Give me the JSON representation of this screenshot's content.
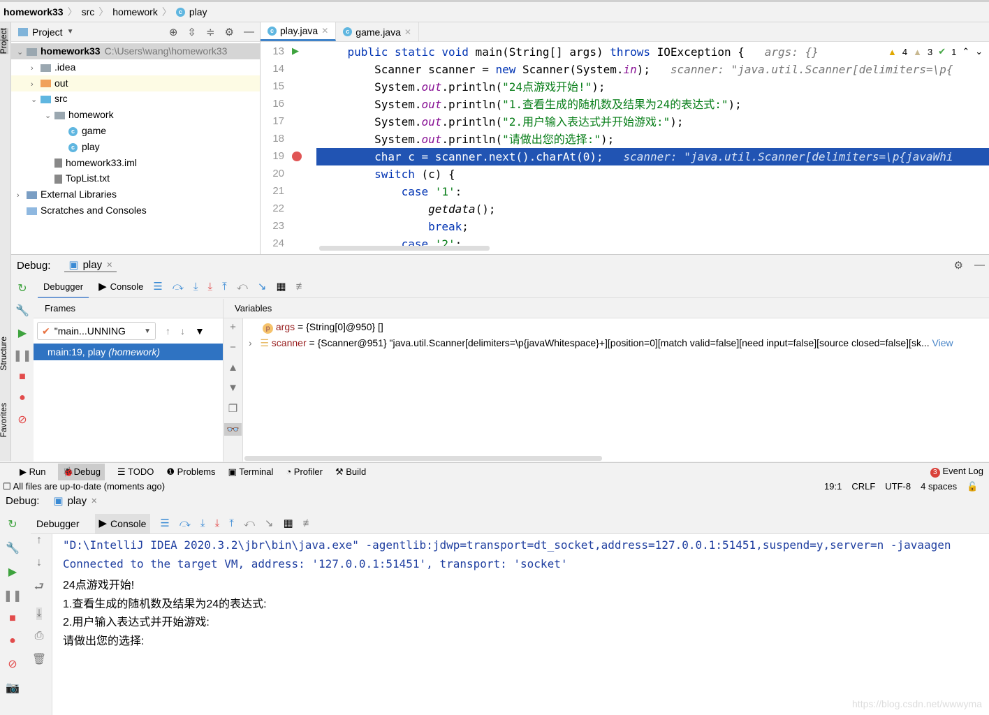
{
  "breadcrumb": [
    "homework33",
    "src",
    "homework",
    "play"
  ],
  "project": {
    "title": "Project",
    "tree": [
      {
        "label": "homework33",
        "path": "C:\\Users\\wang\\homework33",
        "depth": 0,
        "arrow": "v"
      },
      {
        "label": ".idea",
        "depth": 1,
        "arrow": ">"
      },
      {
        "label": "out",
        "depth": 1,
        "arrow": ">"
      },
      {
        "label": "src",
        "depth": 1,
        "arrow": "v"
      },
      {
        "label": "homework",
        "depth": 2,
        "arrow": "v"
      },
      {
        "label": "game",
        "depth": 3
      },
      {
        "label": "play",
        "depth": 3
      },
      {
        "label": "homework33.iml",
        "depth": 2
      },
      {
        "label": "TopList.txt",
        "depth": 2
      },
      {
        "label": "External Libraries",
        "depth": 0,
        "arrow": ">"
      },
      {
        "label": "Scratches and Consoles",
        "depth": 0
      }
    ]
  },
  "side_labels": {
    "project": "Project",
    "structure": "Structure",
    "favorites": "Favorites"
  },
  "editor": {
    "tabs": [
      "play.java",
      "game.java"
    ],
    "inspections": {
      "warnings": "4",
      "weak_warnings": "3",
      "ok": "1"
    },
    "lines": [
      {
        "n": "13",
        "html": "    <span class='kw'>public static void</span> main(String[] args) <span class='kw'>throws</span> IOException {   <span class='hint'>args: {}</span>"
      },
      {
        "n": "14",
        "html": "        Scanner scanner = <span class='kw'>new</span> Scanner(System.<span class='fld'>in</span>);   <span class='hint'>scanner: \"java.util.Scanner[delimiters=\\p{</span>"
      },
      {
        "n": "15",
        "html": "        System.<span class='fld'>out</span>.println(<span class='str'>\"24点游戏开始!\"</span>);"
      },
      {
        "n": "16",
        "html": "        System.<span class='fld'>out</span>.println(<span class='str'>\"1.查看生成的随机数及结果为24的表达式:\"</span>);"
      },
      {
        "n": "17",
        "html": "        System.<span class='fld'>out</span>.println(<span class='str'>\"2.用户输入表达式并开始游戏:\"</span>);"
      },
      {
        "n": "18",
        "html": "        System.<span class='fld'>out</span>.println(<span class='str'>\"请做出您的选择:\"</span>);"
      },
      {
        "n": "19",
        "html": "        char c = scanner.next().charAt(<span>0</span>);   <span class='hint'>scanner: \"java.util.Scanner[delimiters=\\p{javaWhi</span>"
      },
      {
        "n": "20",
        "html": "        <span class='kw'>switch</span> (c) {"
      },
      {
        "n": "21",
        "html": "            <span class='kw'>case</span> <span class='str'>'1'</span>:"
      },
      {
        "n": "22",
        "html": "                <i>getdata</i>();"
      },
      {
        "n": "23",
        "html": "                <span class='kw'>break</span>;"
      },
      {
        "n": "24",
        "html": "            <span class='kw'>case</span> <span class='str'>'2'</span>:"
      }
    ]
  },
  "debug": {
    "label": "Debug:",
    "session": "play",
    "tabs": {
      "debugger": "Debugger",
      "console": "Console"
    },
    "frames_title": "Frames",
    "variables_title": "Variables",
    "thread": "\"main...UNNING",
    "frame": "main:19, play",
    "frame_pkg": "(homework)",
    "variables": [
      {
        "name": "args",
        "value": "{String[0]@950} []"
      },
      {
        "name": "scanner",
        "value": "{Scanner@951} \"java.util.Scanner[delimiters=\\p{javaWhitespace}+][position=0][match valid=false][need input=false][source closed=false][sk...",
        "link": "View"
      }
    ]
  },
  "bottom_tools": [
    "Run",
    "Debug",
    "TODO",
    "Problems",
    "Terminal",
    "Profiler",
    "Build"
  ],
  "event_log": {
    "label": "Event Log",
    "count": "3"
  },
  "status": {
    "message": "All files are up-to-date (moments ago)",
    "position": "19:1",
    "line_sep": "CRLF",
    "encoding": "UTF-8",
    "indent": "4 spaces"
  },
  "console_lines": [
    "\"D:\\IntelliJ IDEA 2020.3.2\\jbr\\bin\\java.exe\" -agentlib:jdwp=transport=dt_socket,address=127.0.0.1:51451,suspend=y,server=n -javaagen",
    "Connected to the target VM, address: '127.0.0.1:51451', transport: 'socket'",
    "24点游戏开始!",
    "1.查看生成的随机数及结果为24的表达式:",
    "2.用户输入表达式并开始游戏:",
    "请做出您的选择:"
  ],
  "watermark": "https://blog.csdn.net/wwwyma"
}
